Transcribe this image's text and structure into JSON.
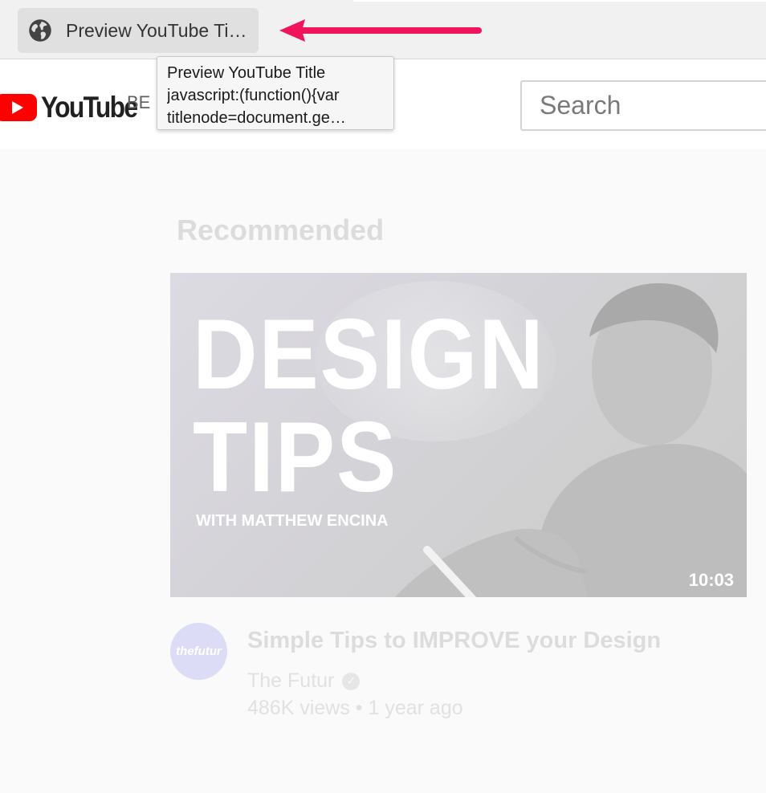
{
  "bookmarks_bar": {
    "bookmark_label": "Preview YouTube Ti…",
    "bookmark_icon": "globe-icon"
  },
  "tooltip": {
    "line1": "Preview YouTube Title",
    "line2": "javascript:(function(){var",
    "line3": "titlenode=document.ge…"
  },
  "header": {
    "logo_text": "YouTube",
    "country_code": "BE",
    "search_placeholder": "Search"
  },
  "main": {
    "section_heading": "Recommended",
    "video": {
      "thumbnail_line1": "DESIGN",
      "thumbnail_line2": "TIPS",
      "thumbnail_subtitle": "WITH MATTHEW ENCINA",
      "duration": "10:03",
      "avatar_text": "thefutur",
      "title": "Simple Tips to IMPROVE your Design",
      "channel": "The Futur",
      "meta": "486K views • 1 year ago"
    }
  },
  "colors": {
    "arrow": "#f0145a",
    "youtube_red": "#ff0000",
    "bookmarks_bar_bg": "#f1f1f1"
  }
}
